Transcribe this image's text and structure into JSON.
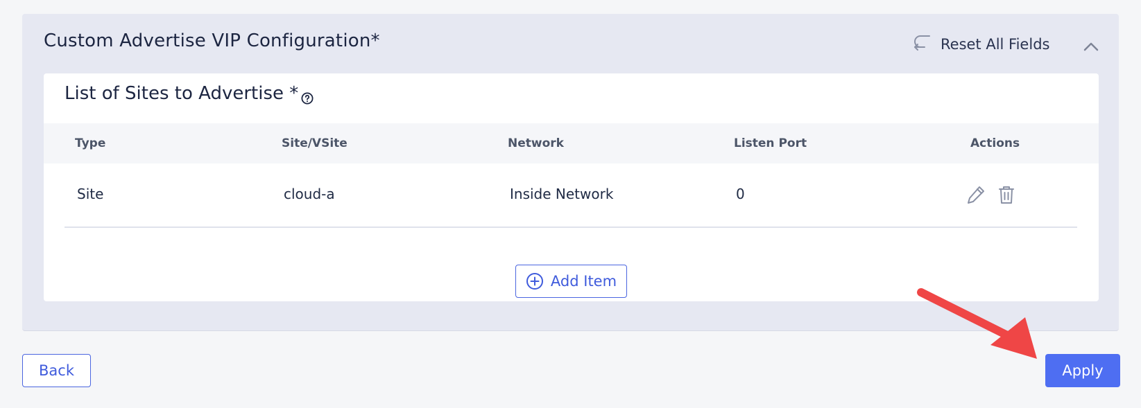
{
  "section": {
    "title": "Custom Advertise VIP Configuration*",
    "reset_label": "Reset All Fields"
  },
  "card": {
    "title": "List of Sites to Advertise *",
    "columns": [
      "Type",
      "Site/VSite",
      "Network",
      "Listen Port",
      "Actions"
    ],
    "rows": [
      {
        "type": "Site",
        "site": "cloud-a",
        "network": "Inside Network",
        "listen_port": "0"
      }
    ],
    "add_label": "Add Item"
  },
  "footer": {
    "back_label": "Back",
    "apply_label": "Apply"
  },
  "icons": {
    "reset": "undo-arrow-icon",
    "collapse": "chevron-up-icon",
    "help": "question-circle-icon",
    "edit": "pencil-icon",
    "delete": "trash-icon",
    "add": "plus-circle-icon"
  },
  "colors": {
    "accent": "#4e6ef2",
    "annotation_arrow": "#ef4444",
    "section_bg": "#e6e8f2"
  }
}
